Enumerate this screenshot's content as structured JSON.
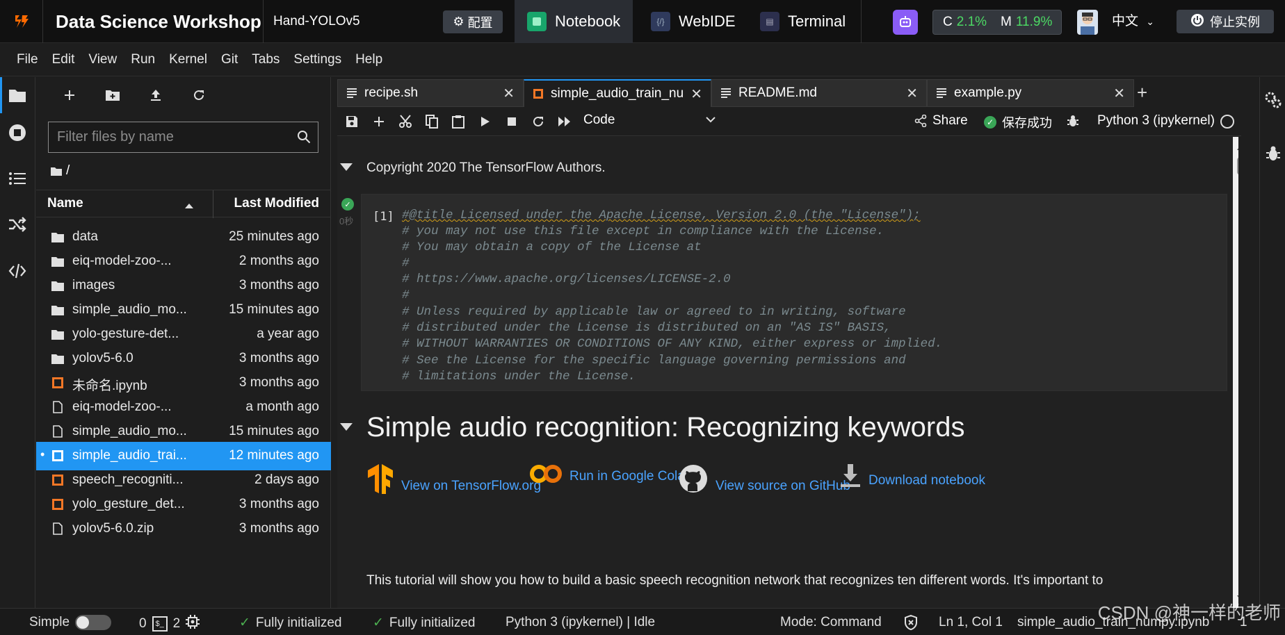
{
  "header": {
    "app_title": "Data Science Workshop",
    "project": "Hand-YOLOv5",
    "config_label": "配置",
    "modes": [
      {
        "label": "Notebook",
        "icon": "notebook-icon"
      },
      {
        "label": "WebIDE",
        "icon": "webide-icon"
      },
      {
        "label": "Terminal",
        "icon": "terminal-icon"
      }
    ],
    "cpu_label": "C",
    "cpu_value": "2.1%",
    "mem_label": "M",
    "mem_value": "11.9%",
    "language": "中文",
    "stop_label": "停止实例",
    "colors": {
      "accent": "#2196f3",
      "ok": "#4cd964",
      "robot": "#8a5cf6"
    }
  },
  "menu": [
    "File",
    "Edit",
    "View",
    "Run",
    "Kernel",
    "Git",
    "Tabs",
    "Settings",
    "Help"
  ],
  "filebrowser": {
    "filter_placeholder": "Filter files by name",
    "path": "/",
    "col_name": "Name",
    "col_modified": "Last Modified",
    "files": [
      {
        "name": "data",
        "modified": "25 minutes ago",
        "type": "folder"
      },
      {
        "name": "eiq-model-zoo-...",
        "modified": "2 months ago",
        "type": "folder"
      },
      {
        "name": "images",
        "modified": "3 months ago",
        "type": "folder"
      },
      {
        "name": "simple_audio_mo...",
        "modified": "15 minutes ago",
        "type": "folder"
      },
      {
        "name": "yolo-gesture-det...",
        "modified": "a year ago",
        "type": "folder"
      },
      {
        "name": "yolov5-6.0",
        "modified": "3 months ago",
        "type": "folder"
      },
      {
        "name": "未命名.ipynb",
        "modified": "3 months ago",
        "type": "notebook"
      },
      {
        "name": "eiq-model-zoo-...",
        "modified": "a month ago",
        "type": "file"
      },
      {
        "name": "simple_audio_mo...",
        "modified": "15 minutes ago",
        "type": "file"
      },
      {
        "name": "simple_audio_trai...",
        "modified": "12 minutes ago",
        "type": "notebook-open",
        "selected": true
      },
      {
        "name": "speech_recogniti...",
        "modified": "2 days ago",
        "type": "notebook"
      },
      {
        "name": "yolo_gesture_det...",
        "modified": "3 months ago",
        "type": "notebook"
      },
      {
        "name": "yolov5-6.0.zip",
        "modified": "3 months ago",
        "type": "file"
      }
    ]
  },
  "tabs": [
    {
      "label": "recipe.sh",
      "icon": "text-file-icon"
    },
    {
      "label": "simple_audio_train_numpy.ipynb",
      "icon": "notebook-icon",
      "active": true
    },
    {
      "label": "README.md",
      "icon": "text-file-icon"
    },
    {
      "label": "example.py",
      "icon": "text-file-icon"
    }
  ],
  "toolbar": {
    "cell_type": "Code",
    "share": "Share",
    "save_status": "保存成功",
    "kernel": "Python 3 (ipykernel)"
  },
  "notebook": {
    "copyright": "Copyright 2020 The TensorFlow Authors.",
    "exec_time": "0秒",
    "prompt": "[1]",
    "code": [
      "#@title Licensed under the Apache License, Version 2.0 (the \"License\");",
      "# you may not use this file except in compliance with the License.",
      "# You may obtain a copy of the License at",
      "#",
      "# https://www.apache.org/licenses/LICENSE-2.0",
      "#",
      "# Unless required by applicable law or agreed to in writing, software",
      "# distributed under the License is distributed on an \"AS IS\" BASIS,",
      "# WITHOUT WARRANTIES OR CONDITIONS OF ANY KIND, either express or implied.",
      "# See the License for the specific language governing permissions and",
      "# limitations under the License."
    ],
    "heading": "Simple audio recognition: Recognizing keywords",
    "links": [
      {
        "label": "View on TensorFlow.org",
        "icon": "tensorflow-logo-icon"
      },
      {
        "label": "Run in Google Colab",
        "icon": "colab-logo-icon"
      },
      {
        "label": "View source on GitHub",
        "icon": "github-logo-icon"
      },
      {
        "label": "Download notebook",
        "icon": "download-icon"
      }
    ],
    "body": "This tutorial will show you how to build a basic speech recognition network that recognizes ten different words. It's important to"
  },
  "status": {
    "mode_label": "Simple",
    "count_a": "0",
    "count_b": "2",
    "init_1": "Fully initialized",
    "init_2": "Fully initialized",
    "kernel_state": "Python 3 (ipykernel) | Idle",
    "mode": "Mode: Command",
    "cursor": "Ln 1, Col 1",
    "file": "simple_audio_train_numpy.ipynb",
    "cell_count": "1"
  },
  "watermark": "CSDN @神一样的老师"
}
